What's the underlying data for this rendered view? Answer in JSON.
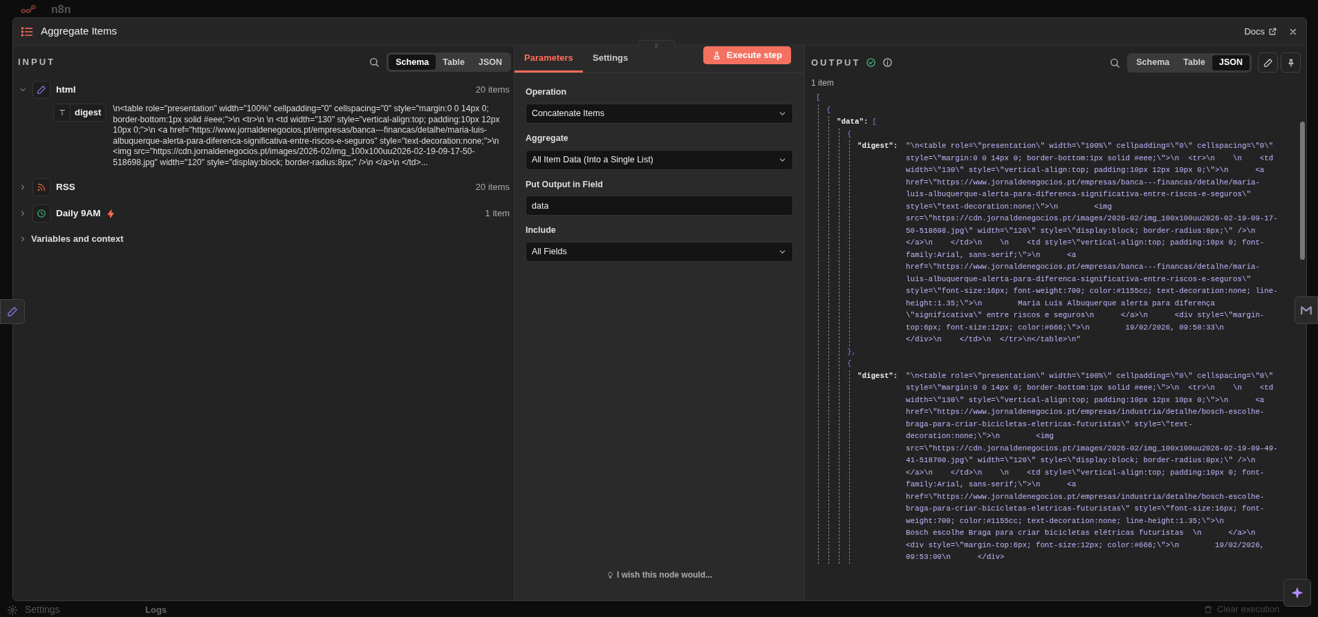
{
  "background": {
    "app_name": "n8n",
    "sidebar_item": "Settings",
    "logs_label": "Logs",
    "clear_button": "Clear execution"
  },
  "window": {
    "title": "Aggregate Items",
    "docs_link": "Docs"
  },
  "input": {
    "heading": "INPUT",
    "view_tabs": [
      {
        "label": "Schema",
        "selected": true
      },
      {
        "label": "Table",
        "selected": false
      },
      {
        "label": "JSON",
        "selected": false
      }
    ],
    "nodes": [
      {
        "kind": "edit",
        "label": "html",
        "count": "20 items",
        "expanded": true,
        "trigger": false,
        "fields": [
          {
            "name": "digest",
            "value": "\\n<table role=\"presentation\" width=\"100%\" cellpadding=\"0\" cellspacing=\"0\" style=\"margin:0 0 14px 0; border-bottom:1px solid #eee;\">\\n <tr>\\n \\n <td width=\"130\" style=\"vertical-align:top; padding:10px 12px 10px 0;\">\\n <a href=\"https://www.jornaldenegocios.pt/empresas/banca---financas/detalhe/maria-luis-albuquerque-alerta-para-diferenca-significativa-entre-riscos-e-seguros\" style=\"text-decoration:none;\">\\n <img src=\"https://cdn.jornaldenegocios.pt/images/2026-02/img_100x100uu2026-02-19-09-17-50-518698.jpg\" width=\"120\" style=\"display:block; border-radius:8px;\" />\\n </a>\\n </td>..."
          }
        ]
      },
      {
        "kind": "rss",
        "label": "RSS",
        "count": "20 items",
        "expanded": false,
        "trigger": false
      },
      {
        "kind": "clock",
        "label": "Daily 9AM",
        "count": "1 item",
        "expanded": false,
        "trigger": true
      }
    ],
    "variables": {
      "label": "Variables and context",
      "expanded": false
    }
  },
  "parameters": {
    "tabs": [
      {
        "label": "Parameters",
        "selected": true
      },
      {
        "label": "Settings",
        "selected": false
      }
    ],
    "execute_button": "Execute step",
    "fields": [
      {
        "kind": "select",
        "label": "Operation",
        "value": "Concatenate Items"
      },
      {
        "kind": "select",
        "label": "Aggregate",
        "value": "All Item Data (Into a Single List)"
      },
      {
        "kind": "text",
        "label": "Put Output in Field",
        "value": "data"
      },
      {
        "kind": "select",
        "label": "Include",
        "value": "All Fields"
      }
    ],
    "feedback_link": "I wish this node would..."
  },
  "output": {
    "heading": "OUTPUT",
    "success": true,
    "view_tabs": [
      {
        "label": "Schema",
        "selected": false
      },
      {
        "label": "Table",
        "selected": false
      },
      {
        "label": "JSON",
        "selected": true
      }
    ],
    "item_count": "1 item",
    "json": {
      "open": "[",
      "children": [
        {
          "open": "{",
          "children": [
            {
              "key": "\"data\":",
              "open": "[",
              "children": [
                {
                  "open": "{",
                  "children": [
                    {
                      "key": "\"digest\":",
                      "value": "\"\\n<table role=\\\"presentation\\\" width=\\\"100%\\\" cellpadding=\\\"0\\\" cellspacing=\\\"0\\\" style=\\\"margin:0 0 14px 0; border-bottom:1px solid #eee;\\\">\\n  <tr>\\n    \\n    <td width=\\\"130\\\" style=\\\"vertical-align:top; padding:10px 12px 10px 0;\\\">\\n      <a href=\\\"https://www.jornaldenegocios.pt/empresas/banca---financas/detalhe/maria-luis-albuquerque-alerta-para-diferenca-significativa-entre-riscos-e-seguros\\\" style=\\\"text-decoration:none;\\\">\\n        <img src=\\\"https://cdn.jornaldenegocios.pt/images/2026-02/img_100x100uu2026-02-19-09-17-50-518698.jpg\\\" width=\\\"120\\\" style=\\\"display:block; border-radius:8px;\\\" />\\n      </a>\\n    </td>\\n    \\n    <td style=\\\"vertical-align:top; padding:10px 0; font-family:Arial, sans-serif;\\\">\\n      <a href=\\\"https://www.jornaldenegocios.pt/empresas/banca---financas/detalhe/maria-luis-albuquerque-alerta-para-diferenca-significativa-entre-riscos-e-seguros\\\" style=\\\"font-size:16px; font-weight:700; color:#1155cc; text-decoration:none; line-height:1.35;\\\">\\n        Maria Luís Albuquerque alerta para diferença \\\"significativa\\\" entre riscos e seguros\\n      </a>\\n      <div style=\\\"margin-top:6px; font-size:12px; color:#666;\\\">\\n        19/02/2026, 09:58:33\\n      </div>\\n    </td>\\n  </tr>\\n</table>\\n\""
                    }
                  ],
                  "close": "},"
                },
                {
                  "open": "{",
                  "children": [
                    {
                      "key": "\"digest\":",
                      "value": "\"\\n<table role=\\\"presentation\\\" width=\\\"100%\\\" cellpadding=\\\"0\\\" cellspacing=\\\"0\\\" style=\\\"margin:0 0 14px 0; border-bottom:1px solid #eee;\\\">\\n  <tr>\\n    \\n    <td width=\\\"130\\\" style=\\\"vertical-align:top; padding:10px 12px 10px 0;\\\">\\n      <a href=\\\"https://www.jornaldenegocios.pt/empresas/industria/detalhe/bosch-escolhe-braga-para-criar-bicicletas-eletricas-futuristas\\\" style=\\\"text-decoration:none;\\\">\\n        <img src=\\\"https://cdn.jornaldenegocios.pt/images/2026-02/img_100x100uu2026-02-19-09-49-41-518700.jpg\\\" width=\\\"120\\\" style=\\\"display:block; border-radius:8px;\\\" />\\n      </a>\\n    </td>\\n    \\n    <td style=\\\"vertical-align:top; padding:10px 0; font-family:Arial, sans-serif;\\\">\\n      <a href=\\\"https://www.jornaldenegocios.pt/empresas/industria/detalhe/bosch-escolhe-braga-para-criar-bicicletas-eletricas-futuristas\\\" style=\\\"font-size:16px; font-weight:700; color:#1155cc; text-decoration:none; line-height:1.35;\\\">\\n        Bosch escolhe Braga para criar bicicletas elétricas futuristas  \\n      </a>\\n      <div style=\\\"margin-top:6px; font-size:12px; color:#666;\\\">\\n        19/02/2026, 09:53:00\\n      </div>"
                    }
                  ]
                }
              ]
            }
          ]
        }
      ]
    }
  }
}
